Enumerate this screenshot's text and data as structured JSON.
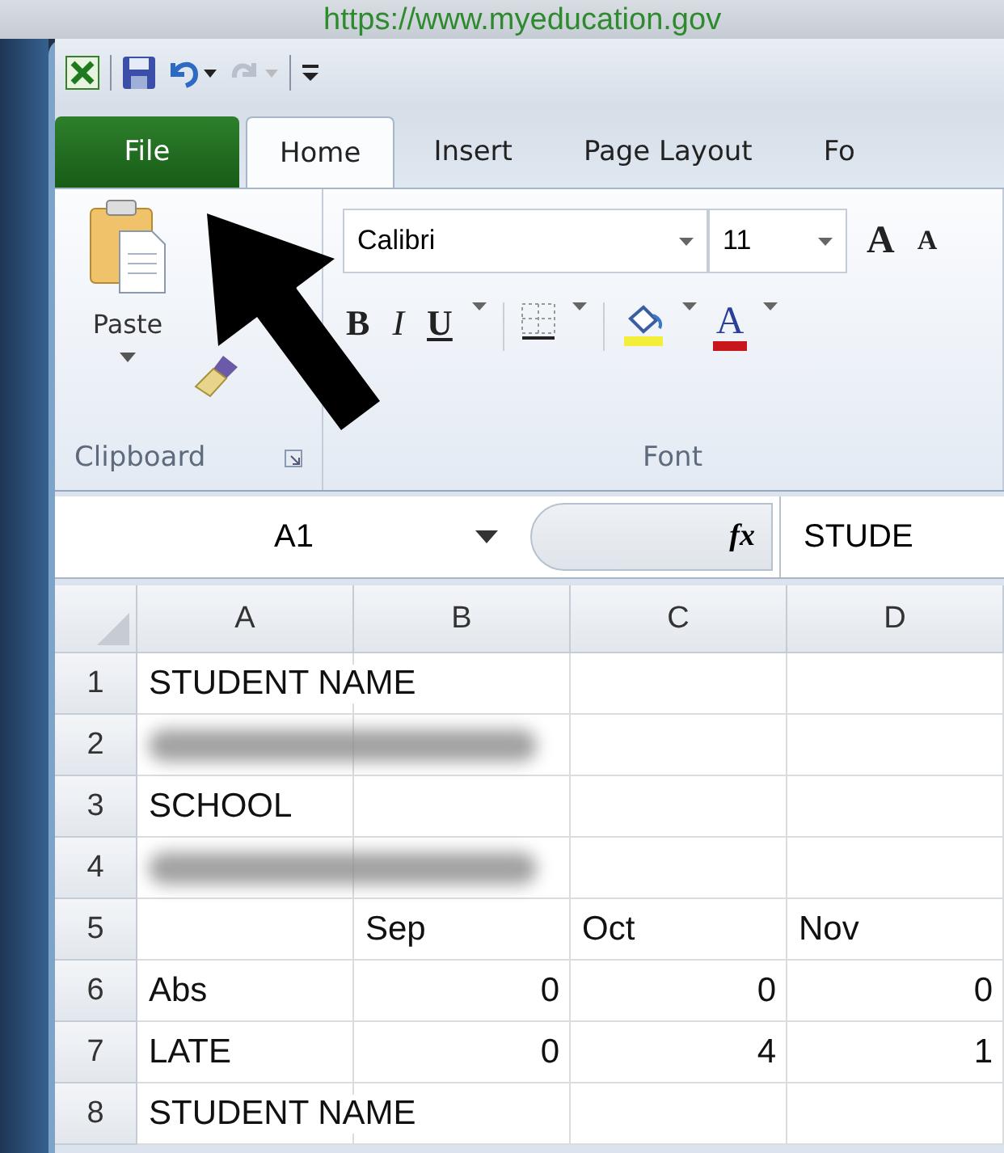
{
  "browser": {
    "url": "https://www.myeducation.gov"
  },
  "tabs": [
    {
      "label": "File",
      "kind": "file",
      "selected": false
    },
    {
      "label": "Home",
      "kind": "tab",
      "selected": true
    },
    {
      "label": "Insert",
      "kind": "tab",
      "selected": false
    },
    {
      "label": "Page Layout",
      "kind": "tab",
      "selected": false
    },
    {
      "label": "Fo",
      "kind": "tab",
      "selected": false
    }
  ],
  "ribbon": {
    "clipboard": {
      "paste_label": "Paste",
      "group_label": "Clipboard"
    },
    "font": {
      "name": "Calibri",
      "size": "11",
      "grow": "A",
      "shrink": "A",
      "bold": "B",
      "italic": "I",
      "underline": "U",
      "font_color": "A",
      "group_label": "Font"
    }
  },
  "formula_bar": {
    "name_box": "A1",
    "fx": "fx",
    "value": "STUDE"
  },
  "sheet": {
    "columns": [
      "A",
      "B",
      "C",
      "D"
    ],
    "rows": [
      {
        "number": "1",
        "cells": [
          {
            "kind": "text",
            "text": "STUDENT NAME"
          },
          {
            "kind": "empty"
          },
          {
            "kind": "empty"
          },
          {
            "kind": "empty"
          }
        ]
      },
      {
        "number": "2",
        "cells": [
          {
            "kind": "redacted"
          },
          {
            "kind": "empty"
          },
          {
            "kind": "empty"
          },
          {
            "kind": "empty"
          }
        ]
      },
      {
        "number": "3",
        "cells": [
          {
            "kind": "text",
            "text": "SCHOOL"
          },
          {
            "kind": "empty"
          },
          {
            "kind": "empty"
          },
          {
            "kind": "empty"
          }
        ]
      },
      {
        "number": "4",
        "cells": [
          {
            "kind": "redacted"
          },
          {
            "kind": "empty"
          },
          {
            "kind": "empty"
          },
          {
            "kind": "empty"
          }
        ]
      },
      {
        "number": "5",
        "cells": [
          {
            "kind": "empty"
          },
          {
            "kind": "text",
            "text": "Sep"
          },
          {
            "kind": "text",
            "text": "Oct"
          },
          {
            "kind": "text",
            "text": "Nov"
          }
        ]
      },
      {
        "number": "6",
        "cells": [
          {
            "kind": "text",
            "text": "Abs"
          },
          {
            "kind": "number",
            "text": "0"
          },
          {
            "kind": "number",
            "text": "0"
          },
          {
            "kind": "number",
            "text": "0"
          }
        ]
      },
      {
        "number": "7",
        "cells": [
          {
            "kind": "text",
            "text": "LATE"
          },
          {
            "kind": "number",
            "text": "0"
          },
          {
            "kind": "number",
            "text": "4"
          },
          {
            "kind": "number",
            "text": "1"
          }
        ]
      },
      {
        "number": "8",
        "cells": [
          {
            "kind": "text",
            "text": "STUDENT NAME"
          },
          {
            "kind": "empty"
          },
          {
            "kind": "empty"
          },
          {
            "kind": "empty"
          }
        ]
      }
    ]
  }
}
